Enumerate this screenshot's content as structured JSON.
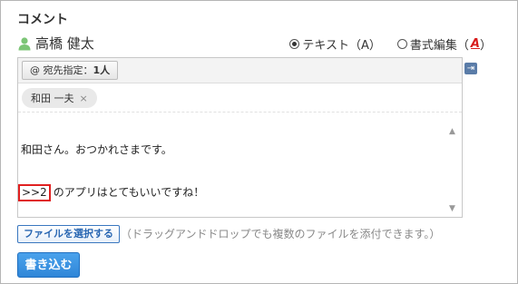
{
  "section_title": "コメント",
  "user": {
    "name": "高橋 健太",
    "icon": "user-icon"
  },
  "mode": {
    "text_option": "テキスト（A）",
    "rich_option": "書式編集（",
    "rich_option_key": "A",
    "rich_option_close": "）",
    "selected": "text"
  },
  "editor": {
    "dest_label": "@ 宛先指定：",
    "dest_count": "1人",
    "recipient": "和田 一夫",
    "recipient_remove": "×",
    "line1": "和田さん。おつかれさまです。",
    "line2_ref": ">>2",
    "line2_rest": "のアプリはとてもいいですね！"
  },
  "file": {
    "button_label": "ファイルを選択する",
    "hint": "（ドラッグアンドドロップでも複数のファイルを添付できます。）"
  },
  "submit_label": "書き込む",
  "colors": {
    "accent": "#2f86d8",
    "ref_highlight": "#e02020",
    "user_icon": "#7cc576"
  }
}
